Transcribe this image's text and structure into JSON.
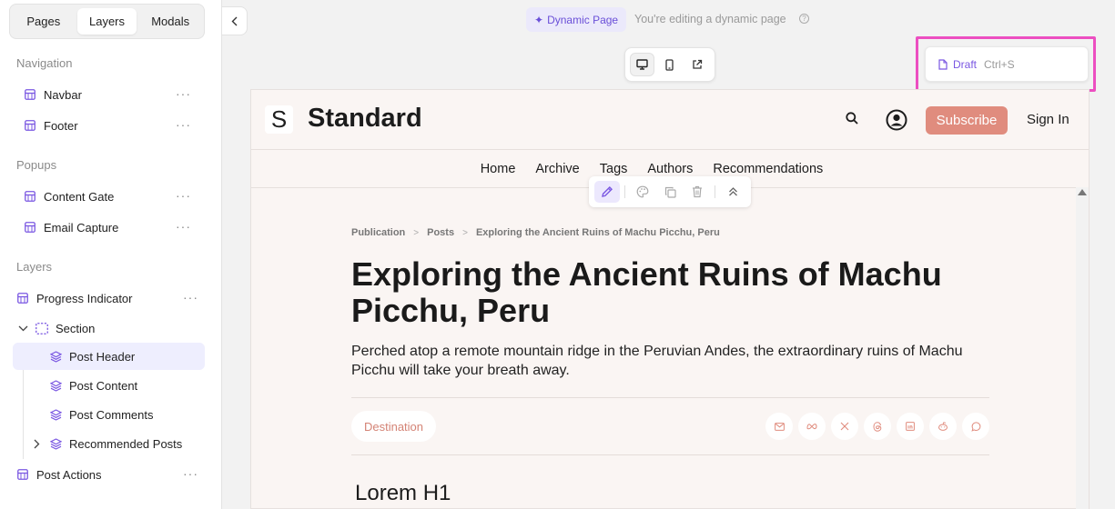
{
  "sidebar": {
    "tabs": [
      "Pages",
      "Layers",
      "Modals"
    ],
    "active_tab": "Layers",
    "groups": {
      "navigation": "Navigation",
      "popups": "Popups",
      "layers": "Layers"
    },
    "navigation_items": [
      "Navbar",
      "Footer"
    ],
    "popup_items": [
      "Content Gate",
      "Email Capture"
    ],
    "layer_items": {
      "progress": "Progress Indicator",
      "section": "Section",
      "post_header": "Post Header",
      "post_content": "Post Content",
      "post_comments": "Post Comments",
      "recommended": "Recommended Posts",
      "post_actions": "Post Actions"
    },
    "more_glyph": "···"
  },
  "topbar": {
    "dynamic_badge": "Dynamic Page",
    "editing_text": "You're editing a dynamic page",
    "draft_label": "Draft",
    "draft_shortcut": "Ctrl+S"
  },
  "site": {
    "logo_letter": "S",
    "title": "Standard",
    "subscribe": "Subscribe",
    "signin": "Sign In",
    "nav": [
      "Home",
      "Archive",
      "Tags",
      "Authors",
      "Recommendations"
    ]
  },
  "post": {
    "breadcrumb": [
      "Publication",
      "Posts",
      "Exploring the Ancient Ruins of Machu Picchu, Peru"
    ],
    "title": "Exploring the Ancient Ruins of Machu Picchu, Peru",
    "subtitle": "Perched atop a remote mountain ridge in the Peruvian Andes, the extraordinary ruins of Machu Picchu will take your breath away.",
    "tag": "Destination",
    "heading": "Lorem H1",
    "share_icons": [
      "email-icon",
      "meta-icon",
      "x-icon",
      "threads-icon",
      "linkedin-icon",
      "reddit-icon",
      "whatsapp-icon"
    ]
  },
  "colors": {
    "accent": "#7a57e2",
    "subscribe": "#e08c7e",
    "highlight": "#ec4fc1",
    "canvas_bg": "#faf5f3"
  }
}
